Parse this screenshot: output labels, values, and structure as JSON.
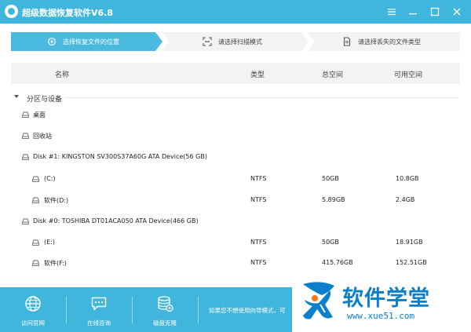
{
  "window": {
    "title": "超级数据恢复软件V6.8",
    "controls": [
      "menu-icon",
      "minimize-icon",
      "maximize-icon",
      "close-icon"
    ]
  },
  "steps": [
    {
      "label": "选择恢复文件的位置",
      "active": true,
      "icon": "target-icon"
    },
    {
      "label": "请选择扫描模式",
      "active": false,
      "icon": "scan-icon"
    },
    {
      "label": "请选择丢失的文件类型",
      "active": false,
      "icon": "document-icon"
    }
  ],
  "table": {
    "columns": [
      "名称",
      "类型",
      "总空间",
      "可用空间"
    ],
    "group_label": "分区与设备",
    "rows": [
      {
        "name": "桌面",
        "type": "",
        "total": "",
        "free": ""
      },
      {
        "name": "回收站",
        "type": "",
        "total": "",
        "free": ""
      },
      {
        "name": "Disk #1: KINGSTON SV300S37A60G ATA Device(56 GB)",
        "type": "",
        "total": "",
        "free": ""
      },
      {
        "name": "(C:)",
        "type": "NTFS",
        "total": "50GB",
        "free": "10.8GB"
      },
      {
        "name": "软件(D:)",
        "type": "NTFS",
        "total": "5.89GB",
        "free": "2.4GB"
      },
      {
        "name": "Disk #0: TOSHIBA DT01ACA050 ATA Device(466 GB)",
        "type": "",
        "total": "",
        "free": ""
      },
      {
        "name": "(E:)",
        "type": "NTFS",
        "total": "50GB",
        "free": "18.91GB"
      },
      {
        "name": "软件(F:)",
        "type": "NTFS",
        "total": "415.76GB",
        "free": "152.51GB"
      }
    ]
  },
  "footer": {
    "items": [
      {
        "label": "访问官网",
        "icon": "globe-icon"
      },
      {
        "label": "在线咨询",
        "icon": "chat-icon"
      },
      {
        "label": "磁盘克隆",
        "icon": "database-icon"
      }
    ],
    "hint": "如果您不想使用向导模式，可"
  },
  "watermark": {
    "text": "软件学堂",
    "url": "www.xue51.com"
  },
  "colors": {
    "accent": "#41b6dc",
    "active_step": "#4ab9de",
    "inactive_step": "#f1f3f5",
    "watermark": "#0b7fc9"
  }
}
